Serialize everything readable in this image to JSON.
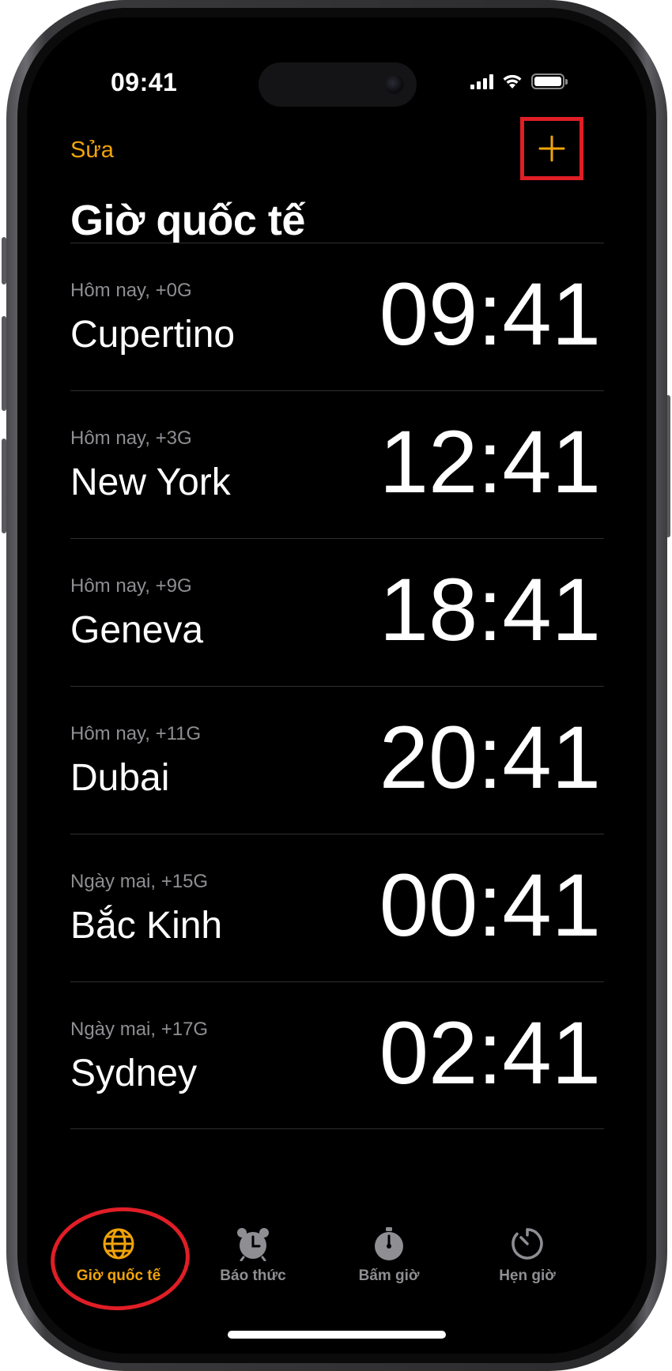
{
  "status_bar": {
    "time": "09:41"
  },
  "nav": {
    "edit_label": "Sửa",
    "add_label": "+"
  },
  "page_title": "Giờ quốc tế",
  "clocks": [
    {
      "offset": "Hôm nay, +0G",
      "city": "Cupertino",
      "time": "09:41"
    },
    {
      "offset": "Hôm nay, +3G",
      "city": "New York",
      "time": "12:41"
    },
    {
      "offset": "Hôm nay, +9G",
      "city": "Geneva",
      "time": "18:41"
    },
    {
      "offset": "Hôm nay, +11G",
      "city": "Dubai",
      "time": "20:41"
    },
    {
      "offset": "Ngày mai, +15G",
      "city": "Bắc Kinh",
      "time": "00:41"
    },
    {
      "offset": "Ngày mai, +17G",
      "city": "Sydney",
      "time": "02:41"
    }
  ],
  "tabs": [
    {
      "label": "Giờ quốc tế",
      "icon": "globe-icon",
      "active": true
    },
    {
      "label": "Báo thức",
      "icon": "alarm-clock-icon",
      "active": false
    },
    {
      "label": "Bấm giờ",
      "icon": "stopwatch-icon",
      "active": false
    },
    {
      "label": "Hẹn giờ",
      "icon": "timer-icon",
      "active": false
    }
  ],
  "colors": {
    "accent": "#f0a30a",
    "highlight": "#e01e26",
    "background": "#000000",
    "secondary_text": "#8e8e93"
  }
}
